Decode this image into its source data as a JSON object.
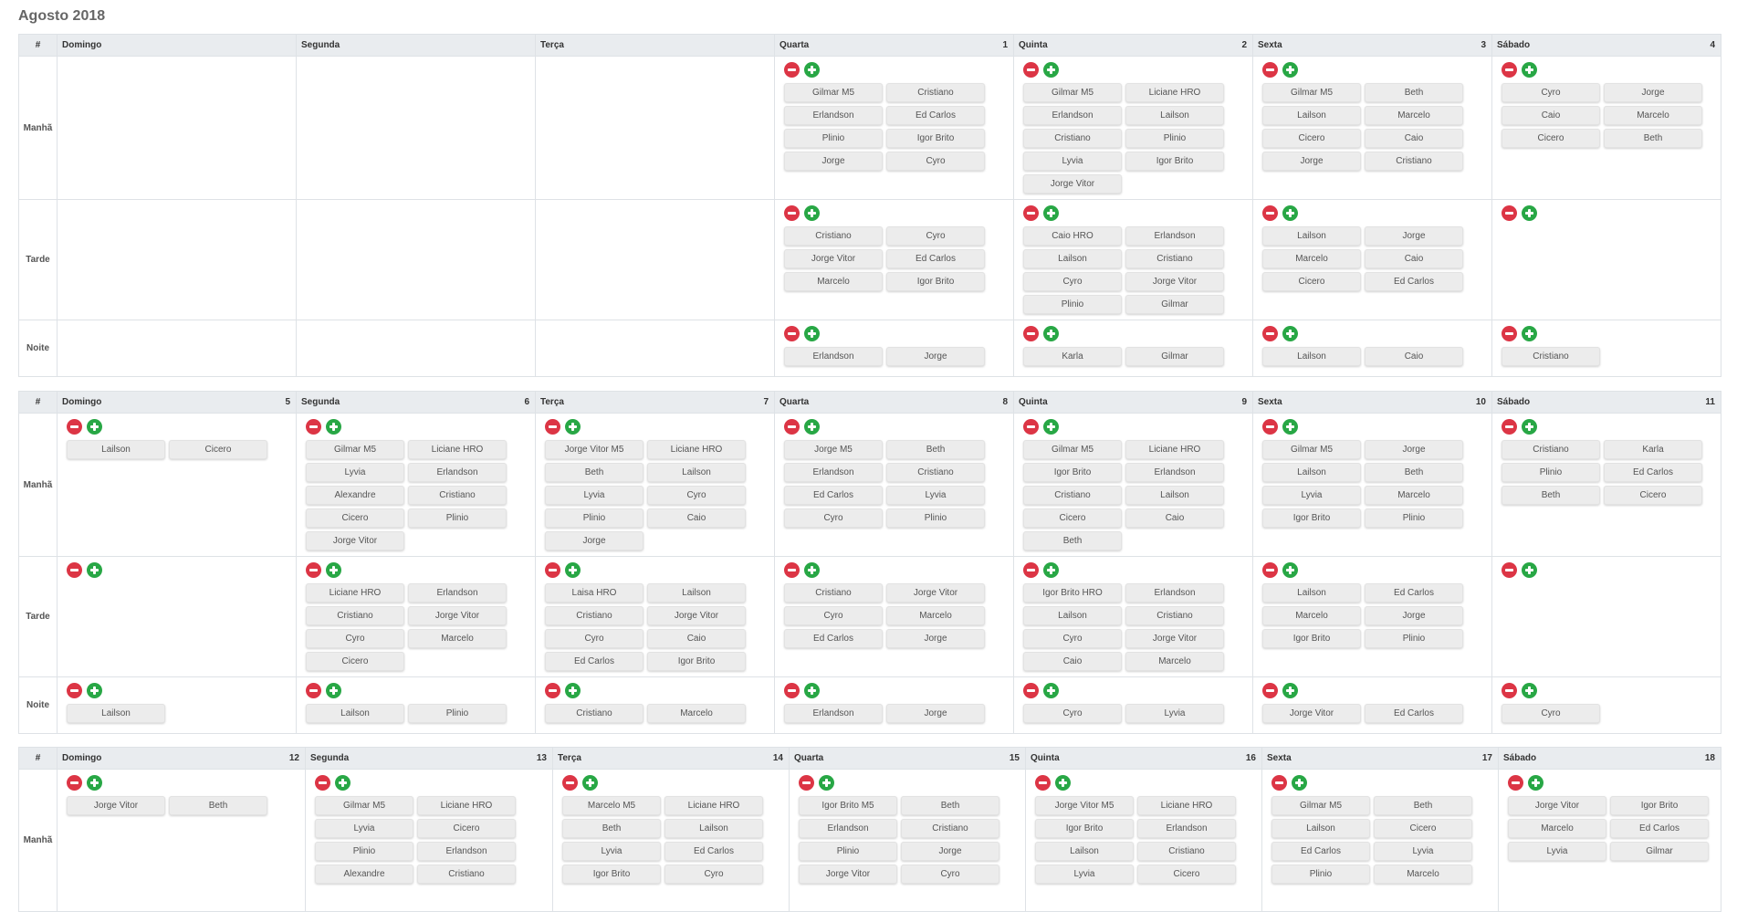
{
  "title": "Agosto 2018",
  "colors": {
    "minus": "#dc3545",
    "plus": "#28a745",
    "header_bg": "#e9ecef"
  },
  "icons": {
    "remove": "minus-circle-icon",
    "add": "plus-circle-icon"
  },
  "hash_label": "#",
  "periods": [
    "Manhã",
    "Tarde",
    "Noite"
  ],
  "weeks": [
    {
      "days": [
        {
          "name": "Domingo",
          "num": "",
          "slots": null
        },
        {
          "name": "Segunda",
          "num": "",
          "slots": null
        },
        {
          "name": "Terça",
          "num": "",
          "slots": null
        },
        {
          "name": "Quarta",
          "num": "1",
          "slots": [
            [
              "Gilmar M5",
              "Cristiano",
              "Erlandson",
              "Ed Carlos",
              "Plinio",
              "Igor Brito",
              "Jorge",
              "Cyro"
            ],
            [
              "Cristiano",
              "Cyro",
              "Jorge Vitor",
              "Ed Carlos",
              "Marcelo",
              "Igor Brito"
            ],
            [
              "Erlandson",
              "Jorge"
            ]
          ]
        },
        {
          "name": "Quinta",
          "num": "2",
          "slots": [
            [
              "Gilmar M5",
              "Liciane HRO",
              "Erlandson",
              "Lailson",
              "Cristiano",
              "Plinio",
              "Lyvia",
              "Igor Brito",
              "Jorge Vitor"
            ],
            [
              "Caio HRO",
              "Erlandson",
              "Lailson",
              "Cristiano",
              "Cyro",
              "Jorge Vitor",
              "Plinio",
              "Gilmar"
            ],
            [
              "Karla",
              "Gilmar"
            ]
          ]
        },
        {
          "name": "Sexta",
          "num": "3",
          "slots": [
            [
              "Gilmar M5",
              "Beth",
              "Lailson",
              "Marcelo",
              "Cicero",
              "Caio",
              "Jorge",
              "Cristiano"
            ],
            [
              "Lailson",
              "Jorge",
              "Marcelo",
              "Caio",
              "Cicero",
              "Ed Carlos"
            ],
            [
              "Lailson",
              "Caio"
            ]
          ]
        },
        {
          "name": "Sábado",
          "num": "4",
          "slots": [
            [
              "Cyro",
              "Jorge",
              "Caio",
              "Marcelo",
              "Cicero",
              "Beth"
            ],
            [],
            [
              "Cristiano"
            ]
          ]
        }
      ]
    },
    {
      "days": [
        {
          "name": "Domingo",
          "num": "5",
          "slots": [
            [
              "Lailson",
              "Cicero"
            ],
            [],
            [
              "Lailson"
            ]
          ]
        },
        {
          "name": "Segunda",
          "num": "6",
          "slots": [
            [
              "Gilmar M5",
              "Liciane HRO",
              "Lyvia",
              "Erlandson",
              "Alexandre",
              "Cristiano",
              "Cicero",
              "Plinio",
              "Jorge Vitor"
            ],
            [
              "Liciane HRO",
              "Erlandson",
              "Cristiano",
              "Jorge Vitor",
              "Cyro",
              "Marcelo",
              "Cicero"
            ],
            [
              "Lailson",
              "Plinio"
            ]
          ]
        },
        {
          "name": "Terça",
          "num": "7",
          "slots": [
            [
              "Jorge Vitor M5",
              "Liciane HRO",
              "Beth",
              "Lailson",
              "Lyvia",
              "Cyro",
              "Plinio",
              "Caio",
              "Jorge"
            ],
            [
              "Laisa HRO",
              "Lailson",
              "Cristiano",
              "Jorge Vitor",
              "Cyro",
              "Caio",
              "Ed Carlos",
              "Igor Brito"
            ],
            [
              "Cristiano",
              "Marcelo"
            ]
          ]
        },
        {
          "name": "Quarta",
          "num": "8",
          "slots": [
            [
              "Jorge M5",
              "Beth",
              "Erlandson",
              "Cristiano",
              "Ed Carlos",
              "Lyvia",
              "Cyro",
              "Plinio"
            ],
            [
              "Cristiano",
              "Jorge Vitor",
              "Cyro",
              "Marcelo",
              "Ed Carlos",
              "Jorge"
            ],
            [
              "Erlandson",
              "Jorge"
            ]
          ]
        },
        {
          "name": "Quinta",
          "num": "9",
          "slots": [
            [
              "Gilmar M5",
              "Liciane HRO",
              "Igor Brito",
              "Erlandson",
              "Cristiano",
              "Lailson",
              "Cicero",
              "Caio",
              "Beth"
            ],
            [
              "Igor Brito HRO",
              "Erlandson",
              "Lailson",
              "Cristiano",
              "Cyro",
              "Jorge Vitor",
              "Caio",
              "Marcelo"
            ],
            [
              "Cyro",
              "Lyvia"
            ]
          ]
        },
        {
          "name": "Sexta",
          "num": "10",
          "slots": [
            [
              "Gilmar M5",
              "Jorge",
              "Lailson",
              "Beth",
              "Lyvia",
              "Marcelo",
              "Igor Brito",
              "Plinio"
            ],
            [
              "Lailson",
              "Ed Carlos",
              "Marcelo",
              "Jorge",
              "Igor Brito",
              "Plinio"
            ],
            [
              "Jorge Vitor",
              "Ed Carlos"
            ]
          ]
        },
        {
          "name": "Sábado",
          "num": "11",
          "slots": [
            [
              "Cristiano",
              "Karla",
              "Plinio",
              "Ed Carlos",
              "Beth",
              "Cicero"
            ],
            [],
            [
              "Cyro"
            ]
          ]
        }
      ]
    },
    {
      "days": [
        {
          "name": "Domingo",
          "num": "12",
          "slots": [
            [
              "Jorge Vitor",
              "Beth"
            ]
          ]
        },
        {
          "name": "Segunda",
          "num": "13",
          "slots": [
            [
              "Gilmar M5",
              "Liciane HRO",
              "Lyvia",
              "Cicero",
              "Plinio",
              "Erlandson",
              "Alexandre",
              "Cristiano"
            ]
          ]
        },
        {
          "name": "Terça",
          "num": "14",
          "slots": [
            [
              "Marcelo M5",
              "Liciane HRO",
              "Beth",
              "Lailson",
              "Lyvia",
              "Ed Carlos",
              "Igor Brito",
              "Cyro"
            ]
          ]
        },
        {
          "name": "Quarta",
          "num": "15",
          "slots": [
            [
              "Igor Brito M5",
              "Beth",
              "Erlandson",
              "Cristiano",
              "Plinio",
              "Jorge",
              "Jorge Vitor",
              "Cyro"
            ]
          ]
        },
        {
          "name": "Quinta",
          "num": "16",
          "slots": [
            [
              "Jorge Vitor M5",
              "Liciane HRO",
              "Igor Brito",
              "Erlandson",
              "Lailson",
              "Cristiano",
              "Lyvia",
              "Cicero"
            ]
          ]
        },
        {
          "name": "Sexta",
          "num": "17",
          "slots": [
            [
              "Gilmar M5",
              "Beth",
              "Lailson",
              "Cicero",
              "Ed Carlos",
              "Lyvia",
              "Plinio",
              "Marcelo"
            ]
          ]
        },
        {
          "name": "Sábado",
          "num": "18",
          "slots": [
            [
              "Jorge Vitor",
              "Igor Brito",
              "Marcelo",
              "Ed Carlos",
              "Lyvia",
              "Gilmar"
            ]
          ]
        }
      ]
    }
  ]
}
